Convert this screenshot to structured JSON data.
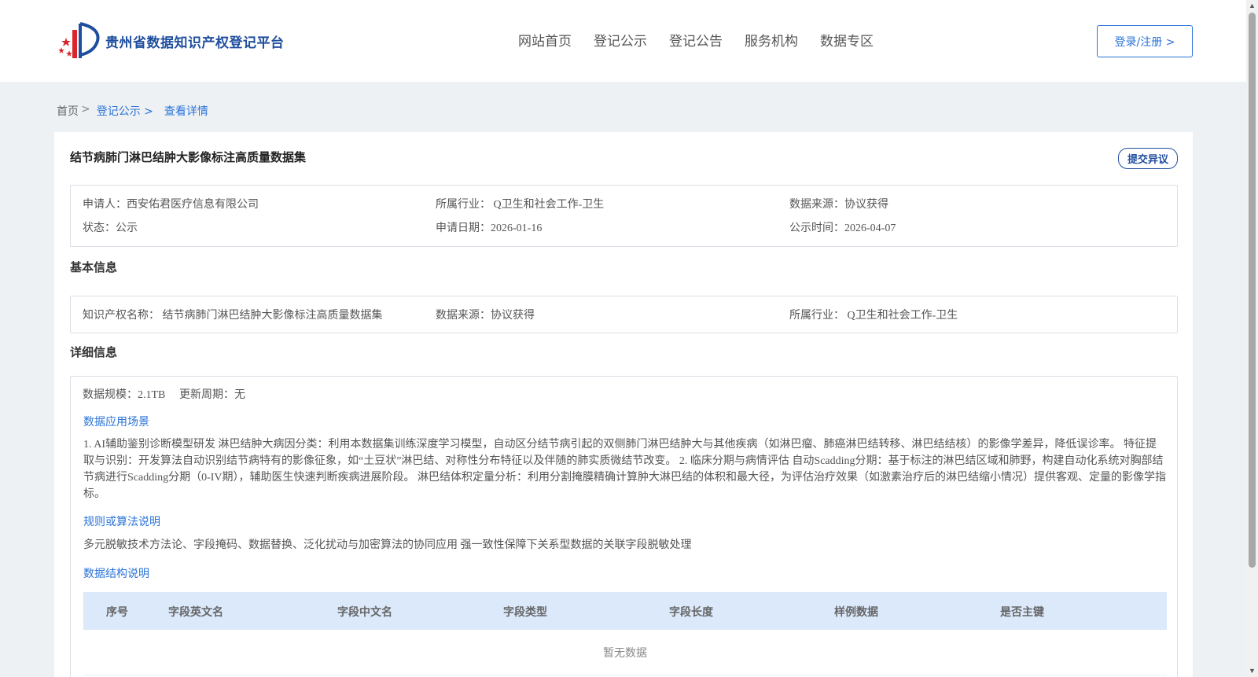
{
  "header": {
    "logo_text": "贵州省数据知识产权登记平台",
    "nav": [
      "网站首页",
      "登记公示",
      "登记公告",
      "服务机构",
      "数据专区"
    ],
    "login_label": "登录/注册 >"
  },
  "breadcrumb": {
    "home": "首页",
    "sep": ">",
    "list": "登记公示 >",
    "current": "查看详情"
  },
  "detail": {
    "title": "结节病肺门淋巴结肿大影像标注高质量数据集",
    "objection_label": "提交异议",
    "summary": {
      "applicant": "申请人：西安佑君医疗信息有限公司",
      "industry": "所属行业： Q卫生和社会工作-卫生",
      "source": "数据来源：协议获得",
      "status": "状态：公示",
      "apply_date": "申请日期：2026-01-16",
      "publish_date": "公示时间：2026-04-07"
    },
    "basic": {
      "section_title": "基本信息",
      "ip_name": "知识产权名称： 结节病肺门淋巴结肿大影像标注高质量数据集",
      "source": "数据来源：协议获得",
      "industry": "所属行业： Q卫生和社会工作-卫生"
    },
    "info": {
      "section_title": "详细信息",
      "scale": "数据规模：2.1TB",
      "update_cycle": "更新周期：无",
      "scene_title": "数据应用场景",
      "scene_text": "1. AI辅助鉴别诊断模型研发 淋巴结肿大病因分类：利用本数据集训练深度学习模型，自动区分结节病引起的双侧肺门淋巴结肿大与其他疾病（如淋巴瘤、肺癌淋巴结转移、淋巴结结核）的影像学差异，降低误诊率。 特征提取与识别：开发算法自动识别结节病特有的影像征象，如“土豆状”淋巴结、对称性分布特征以及伴随的肺实质微结节改变。 2. 临床分期与病情评估 自动Scadding分期：基于标注的淋巴结区域和肺野，构建自动化系统对胸部结节病进行Scadding分期（0-IV期），辅助医生快速判断疾病进展阶段。 淋巴结体积定量分析：利用分割掩膜精确计算肿大淋巴结的体积和最大径，为评估治疗效果（如激素治疗后的淋巴结缩小情况）提供客观、定量的影像学指标。",
      "rule_title": "规则或算法说明",
      "rule_text": "多元脱敏技术方法论、字段掩码、数据替换、泛化扰动与加密算法的协同应用 强一致性保障下关系型数据的关联字段脱敏处理",
      "structure_title": "数据结构说明",
      "table_headers": [
        "序号",
        "字段英文名",
        "字段中文名",
        "字段类型",
        "字段长度",
        "样例数据",
        "是否主键"
      ],
      "empty_text": "暂无数据"
    }
  },
  "colors": {
    "brand": "#1f4e9e",
    "link": "#2a73d8",
    "table_header_bg": "#dbe9fb",
    "page_bg": "#eef1f4"
  },
  "icons": {
    "scroll_up": "▲",
    "scroll_down": "▼"
  }
}
